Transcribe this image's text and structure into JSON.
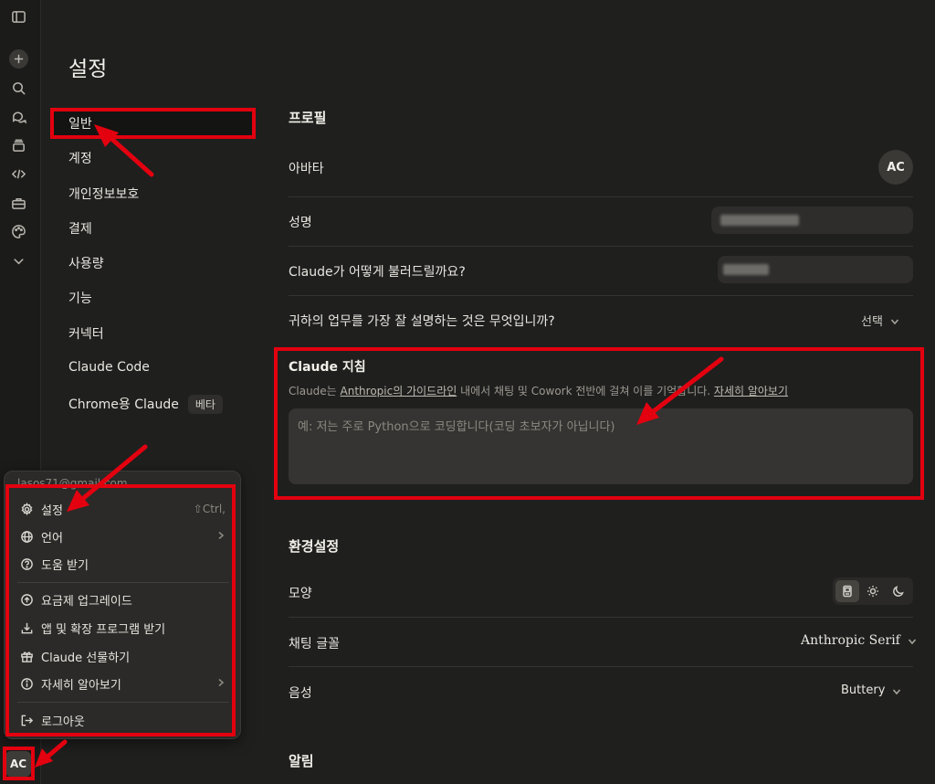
{
  "page": {
    "title": "설정"
  },
  "nav": {
    "items": [
      {
        "label": "일반"
      },
      {
        "label": "계정"
      },
      {
        "label": "개인정보보호"
      },
      {
        "label": "결제"
      },
      {
        "label": "사용량"
      },
      {
        "label": "기능"
      },
      {
        "label": "커넥터"
      },
      {
        "label": "Claude Code"
      },
      {
        "label": "Chrome용 Claude",
        "badge": "베타"
      }
    ]
  },
  "profile": {
    "heading": "프로필",
    "avatar_label": "아바타",
    "avatar_initials": "AC",
    "fullname_label": "성명",
    "callname_label": "Claude가 어떻게 불러드릴까요?",
    "work_label": "귀하의 업무를 가장 잘 설명하는 것은 무엇입니까?",
    "work_value": "선택"
  },
  "instructions": {
    "heading": "Claude 지침",
    "desc_pre": "Claude는 ",
    "desc_link1": "Anthropic의 가이드라인",
    "desc_mid": " 내에서 채팅 및 Cowork 전반에 걸쳐 이를 기억합니다. ",
    "desc_link2": "자세히 알아보기",
    "placeholder": "예: 저는 주로 Python으로 코딩합니다(코딩 초보자가 아닙니다)"
  },
  "preferences": {
    "heading": "환경설정",
    "appearance_label": "모양",
    "font_label": "채팅 글꼴",
    "font_value": "Anthropic Serif",
    "voice_label": "음성",
    "voice_value": "Buttery"
  },
  "notifications": {
    "heading": "알림"
  },
  "menu": {
    "email": "lasos71@gmail.com",
    "items": [
      {
        "label": "설정",
        "shortcut": "⇧Ctrl,"
      },
      {
        "label": "언어"
      },
      {
        "label": "도움 받기"
      },
      {
        "label": "요금제 업그레이드"
      },
      {
        "label": "앱 및 확장 프로그램 받기"
      },
      {
        "label": "Claude 선물하기"
      },
      {
        "label": "자세히 알아보기"
      },
      {
        "label": "로그아웃"
      }
    ]
  },
  "user": {
    "initials": "AC"
  },
  "colors": {
    "annotation": "#e3000f",
    "background": "#1f1f1e"
  }
}
